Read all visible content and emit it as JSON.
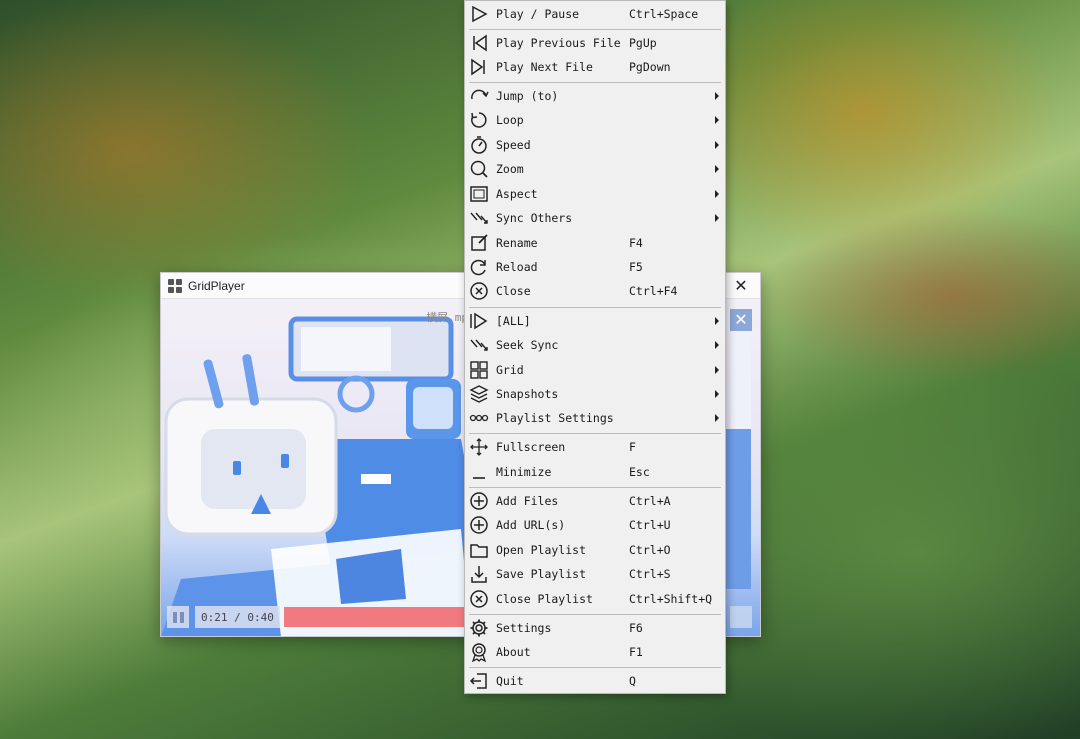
{
  "player": {
    "title": "GridPlayer",
    "close_glyph": "✕",
    "filename": "横屏.mp",
    "time": "0:21 / 0:40",
    "progress_fraction": 0.525
  },
  "menu": {
    "items": [
      {
        "label": "Play / Pause",
        "shortcut": "Ctrl+Space",
        "icon": "play-icon"
      },
      {
        "label": "Play Previous File",
        "shortcut": "PgUp",
        "icon": "previous-icon"
      },
      {
        "label": "Play Next File",
        "shortcut": "PgDown",
        "icon": "next-icon"
      },
      {
        "label": "Jump (to)",
        "shortcut": "",
        "icon": "jump-icon",
        "submenu": true
      },
      {
        "label": "Loop",
        "shortcut": "",
        "icon": "loop-icon",
        "submenu": true
      },
      {
        "label": "Speed",
        "shortcut": "",
        "icon": "speed-icon",
        "submenu": true
      },
      {
        "label": "Zoom",
        "shortcut": "",
        "icon": "zoom-icon",
        "submenu": true
      },
      {
        "label": "Aspect",
        "shortcut": "",
        "icon": "aspect-icon",
        "submenu": true
      },
      {
        "label": "Sync Others",
        "shortcut": "",
        "icon": "sync-icon",
        "submenu": true
      },
      {
        "label": "Rename",
        "shortcut": "F4",
        "icon": "rename-icon"
      },
      {
        "label": "Reload",
        "shortcut": "F5",
        "icon": "reload-icon"
      },
      {
        "label": "Close",
        "shortcut": "Ctrl+F4",
        "icon": "close-icon"
      },
      {
        "label": "[ALL]",
        "shortcut": "",
        "icon": "all-icon",
        "submenu": true
      },
      {
        "label": "Seek Sync",
        "shortcut": "",
        "icon": "seek-sync-icon",
        "submenu": true
      },
      {
        "label": "Grid",
        "shortcut": "",
        "icon": "grid-icon",
        "submenu": true
      },
      {
        "label": "Snapshots",
        "shortcut": "",
        "icon": "snapshots-icon",
        "submenu": true
      },
      {
        "label": "Playlist Settings",
        "shortcut": "",
        "icon": "playlist-settings-icon",
        "submenu": true
      },
      {
        "label": "Fullscreen",
        "shortcut": "F",
        "icon": "fullscreen-icon"
      },
      {
        "label": "Minimize",
        "shortcut": "Esc",
        "icon": "minimize-icon"
      },
      {
        "label": "Add Files",
        "shortcut": "Ctrl+A",
        "icon": "add-files-icon"
      },
      {
        "label": "Add URL(s)",
        "shortcut": "Ctrl+U",
        "icon": "add-url-icon"
      },
      {
        "label": "Open Playlist",
        "shortcut": "Ctrl+O",
        "icon": "folder-icon"
      },
      {
        "label": "Save Playlist",
        "shortcut": "Ctrl+S",
        "icon": "save-icon"
      },
      {
        "label": "Close Playlist",
        "shortcut": "Ctrl+Shift+Q",
        "icon": "close-playlist-icon"
      },
      {
        "label": "Settings",
        "shortcut": "F6",
        "icon": "gear-icon"
      },
      {
        "label": "About",
        "shortcut": "F1",
        "icon": "about-icon"
      },
      {
        "label": "Quit",
        "shortcut": "Q",
        "icon": "quit-icon"
      }
    ]
  }
}
